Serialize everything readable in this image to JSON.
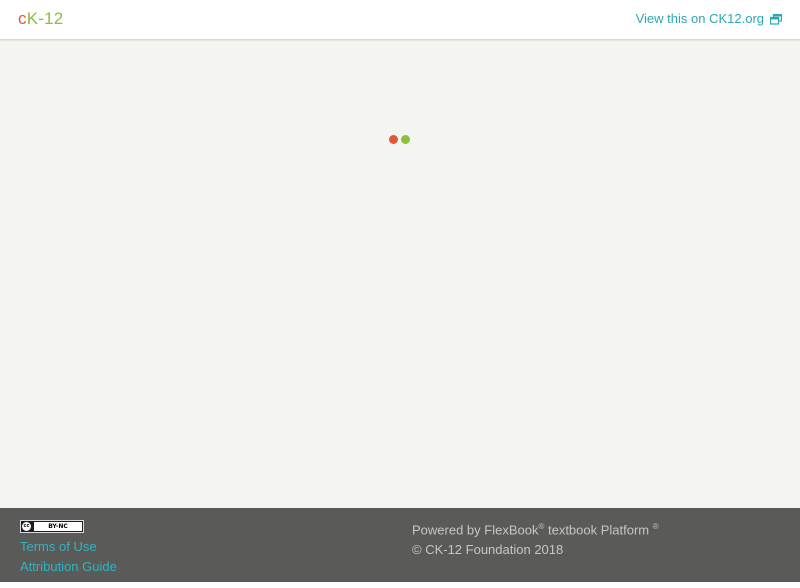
{
  "header": {
    "logo": {
      "c": "c",
      "k": "K",
      "rest": "-12"
    },
    "view_link_label": "View this on CK12.org",
    "view_link_icon": "external-window-icon"
  },
  "main": {
    "loader": {
      "dot_colors": [
        "#e0583a",
        "#8bbf3c"
      ]
    }
  },
  "footer": {
    "license_badge": {
      "symbol": "cc",
      "label": "BY-NC"
    },
    "links": [
      {
        "label": "Terms of Use"
      },
      {
        "label": "Attribution Guide"
      }
    ],
    "powered_by": {
      "prefix": "Powered by FlexBook",
      "reg": "®",
      "suffix": " textbook Platform ",
      "reg2": "®"
    },
    "copyright": "© CK-12 Foundation 2018"
  },
  "colors": {
    "accent_teal": "#2aa8b4",
    "brand_orange": "#e0583a",
    "brand_green": "#8bbf3c",
    "footer_bg": "#5a5a59",
    "page_bg": "#f4f4f1"
  }
}
